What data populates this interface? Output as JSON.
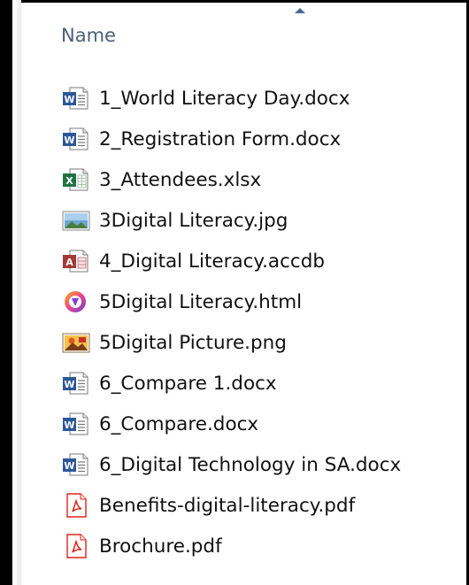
{
  "header": {
    "name_column": "Name"
  },
  "files": [
    {
      "name": "1_World Literacy Day.docx",
      "icon": "word-doc-icon"
    },
    {
      "name": "2_Registration Form.docx",
      "icon": "word-doc-icon"
    },
    {
      "name": "3_Attendees.xlsx",
      "icon": "excel-sheet-icon"
    },
    {
      "name": "3Digital Literacy.jpg",
      "icon": "image-file-icon"
    },
    {
      "name": "4_Digital Literacy.accdb",
      "icon": "access-db-icon"
    },
    {
      "name": "5Digital Literacy.html",
      "icon": "browser-html-icon"
    },
    {
      "name": "5Digital Picture.png",
      "icon": "picture-file-icon"
    },
    {
      "name": "6_Compare 1.docx",
      "icon": "word-doc-icon"
    },
    {
      "name": "6_Compare.docx",
      "icon": "word-doc-icon"
    },
    {
      "name": "6_Digital Technology in SA.docx",
      "icon": "word-doc-icon"
    },
    {
      "name": "Benefits-digital-literacy.pdf",
      "icon": "pdf-file-icon"
    },
    {
      "name": "Brochure.pdf",
      "icon": "pdf-file-icon"
    }
  ],
  "colors": {
    "header_text": "#4c607a",
    "word_blue": "#2b579a",
    "excel_green": "#217346",
    "access_red": "#a4373a",
    "pdf_red": "#e2231a"
  }
}
